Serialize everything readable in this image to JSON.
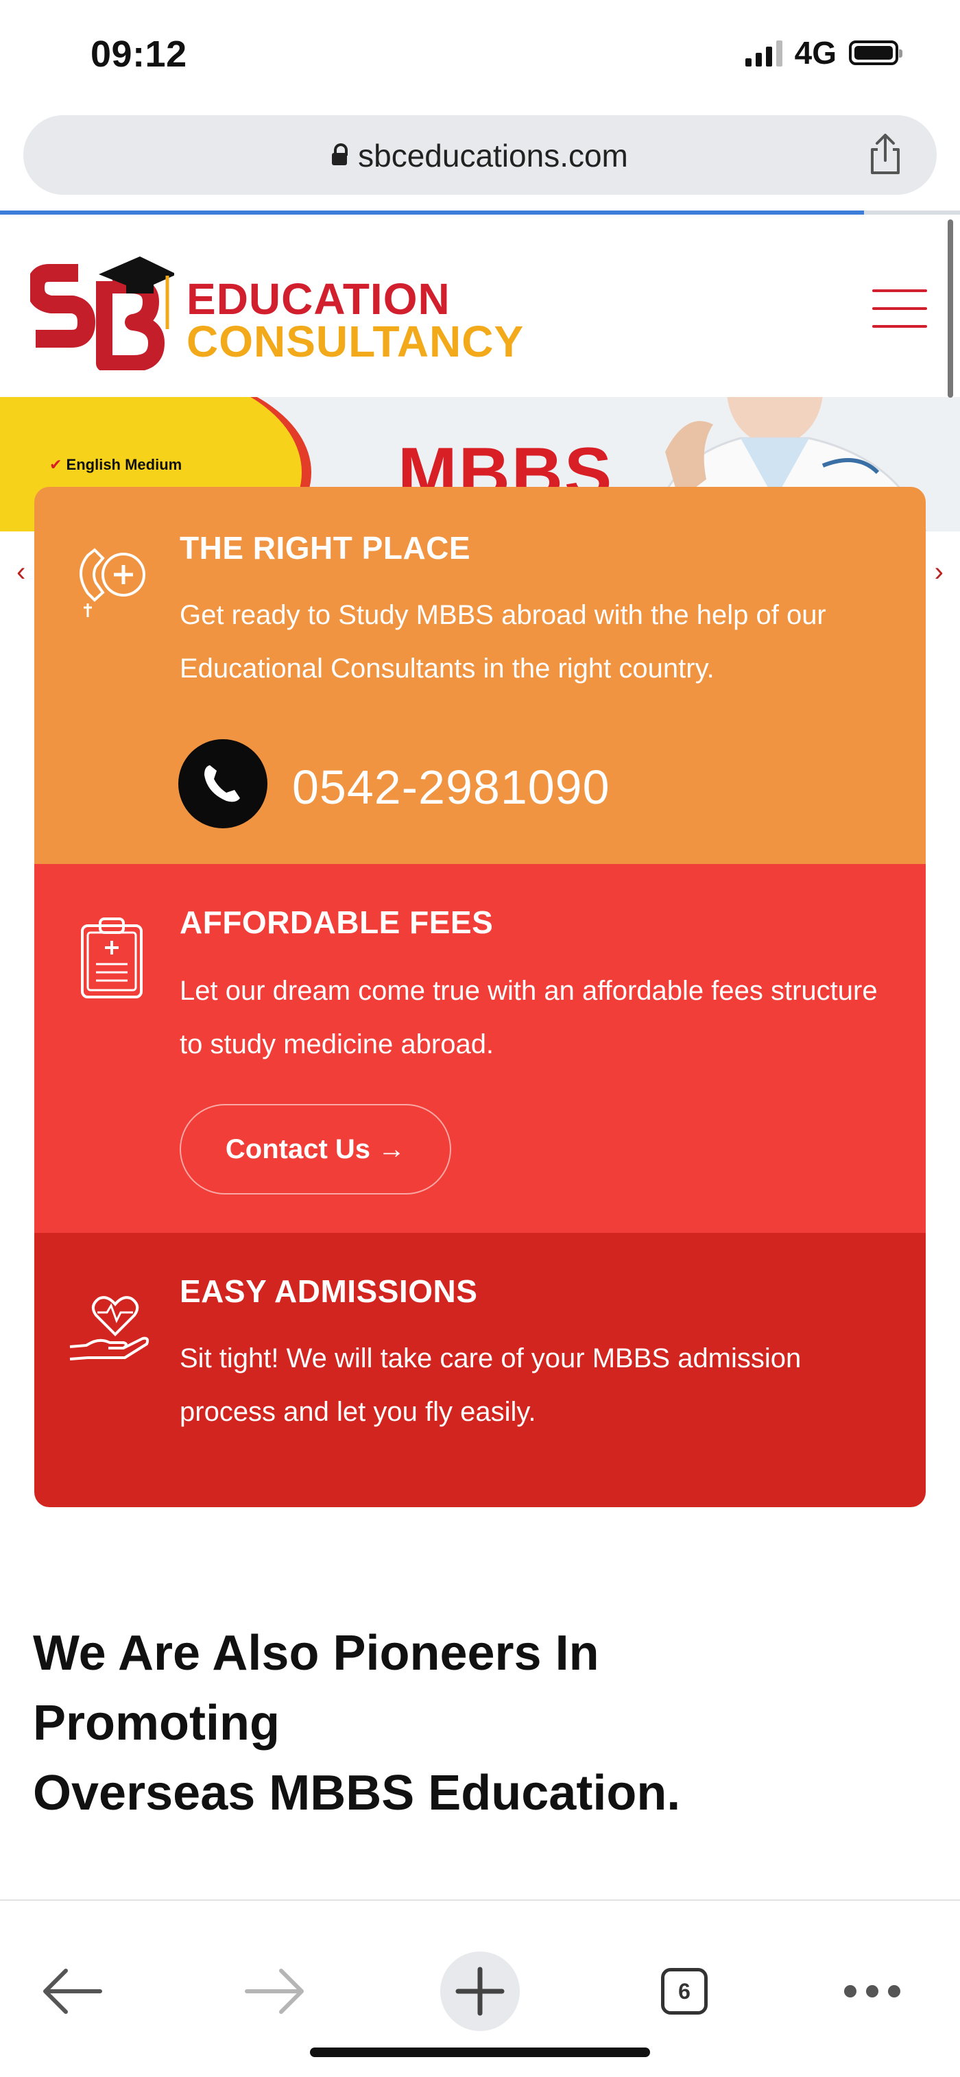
{
  "status_bar": {
    "time": "09:12",
    "network": "4G"
  },
  "browser": {
    "url": "sbceducations.com",
    "open_tabs": "6",
    "load_progress": 0.9
  },
  "header": {
    "logo_line1": "EDUCATION",
    "logo_line2": "CONSULTANCY",
    "logo_letters": "SB"
  },
  "banner": {
    "headline": "MBBS",
    "bullets": [
      "English Medium"
    ]
  },
  "cards": [
    {
      "title": "THE RIGHT PLACE",
      "text": "Get ready to Study MBBS abroad with the help of our Educational Consultants in the right country.",
      "phone": "0542-2981090",
      "color": "#f09441",
      "icon": "phone-plus-icon"
    },
    {
      "title": "AFFORDABLE FEES",
      "text": "Let our dream come true with an affordable fees structure to study medicine abroad.",
      "button": "Contact Us →",
      "color": "#f23e38",
      "icon": "clipboard-icon"
    },
    {
      "title": "EASY ADMISSIONS",
      "text": "Sit tight! We will take care of your MBBS admission process and let you fly easily.",
      "color": "#d3251f",
      "icon": "heart-hand-icon"
    }
  ],
  "section": {
    "heading_line1": "We Are Also Pioneers In",
    "heading_line2": "Promoting",
    "heading_line3": "Overseas MBBS Education."
  },
  "colors": {
    "brand_red": "#d11f2e",
    "brand_yellow": "#f2a91a",
    "browser_accent": "#3b7dd8"
  }
}
